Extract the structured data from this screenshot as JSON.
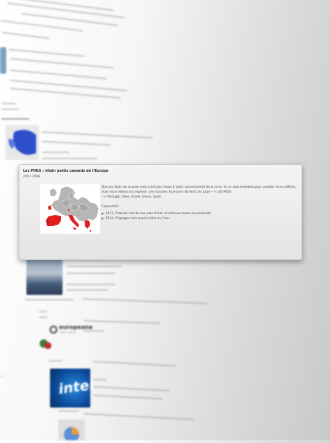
{
  "card": {
    "title": "Les PIIGS : vilain petits canards de l'Europe",
    "date": "2007-2008",
    "body_paragraph": "Tous les états de la zone euro n'ont pas réussi à sortir correctement de la crise. Ils se sont endettés pour combler leurs déficits, mais leurs dettes ont explosé. Les marchés financiers lâchent ces pays --> LES PIIGS",
    "countries_line": "--> Portugal, Italie, Irland, Grece, Spain",
    "cependant": "Cependant :",
    "bullets": [
      "2013, l'Irlande sort de son plan d'aide et retrouve toute souveraineté",
      "2014, l'Espagne sort aussi la tete de l'eau"
    ],
    "highlight_color": "#e11e1e"
  },
  "background": {
    "europeana_logo": "europeana",
    "europeana_tagline": "think culture",
    "intel_logo": "intel"
  }
}
